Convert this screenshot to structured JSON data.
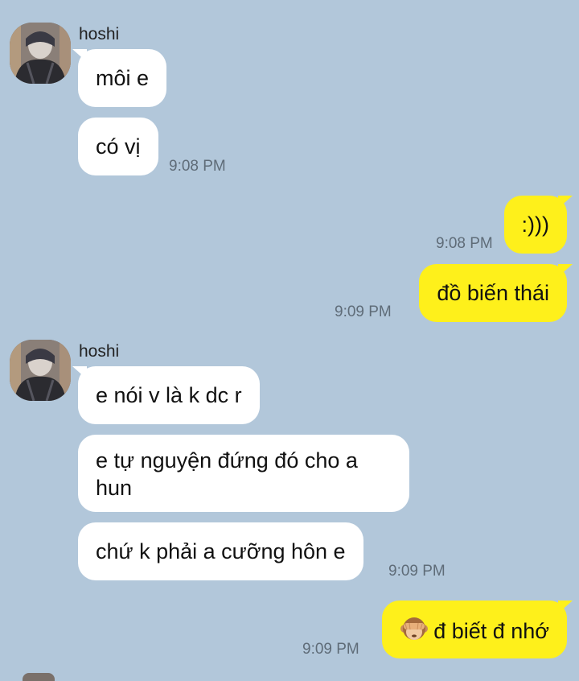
{
  "chat": {
    "groups": [
      {
        "sender": "hoshi",
        "messages": [
          "môi e",
          "có vị"
        ],
        "time": "9:08 PM"
      },
      {
        "outgoing": [
          ":)))"
        ],
        "time": "9:08 PM"
      },
      {
        "outgoing": [
          "đồ biến thái"
        ],
        "time": "9:09 PM"
      },
      {
        "sender": "hoshi",
        "messages": [
          "e nói v là k dc r",
          "e tự nguyện đứng đó cho a hun",
          "chứ k phải a cưỡng hôn e"
        ],
        "time": "9:09 PM"
      },
      {
        "outgoing": [
          "đ biết đ nhớ"
        ],
        "emoji": "see-no-evil-monkey-icon",
        "time": "9:09 PM"
      }
    ]
  },
  "colors": {
    "background": "#b2c7da",
    "incoming_bubble": "#ffffff",
    "outgoing_bubble": "#fef01b",
    "timestamp": "#5f6c78"
  }
}
